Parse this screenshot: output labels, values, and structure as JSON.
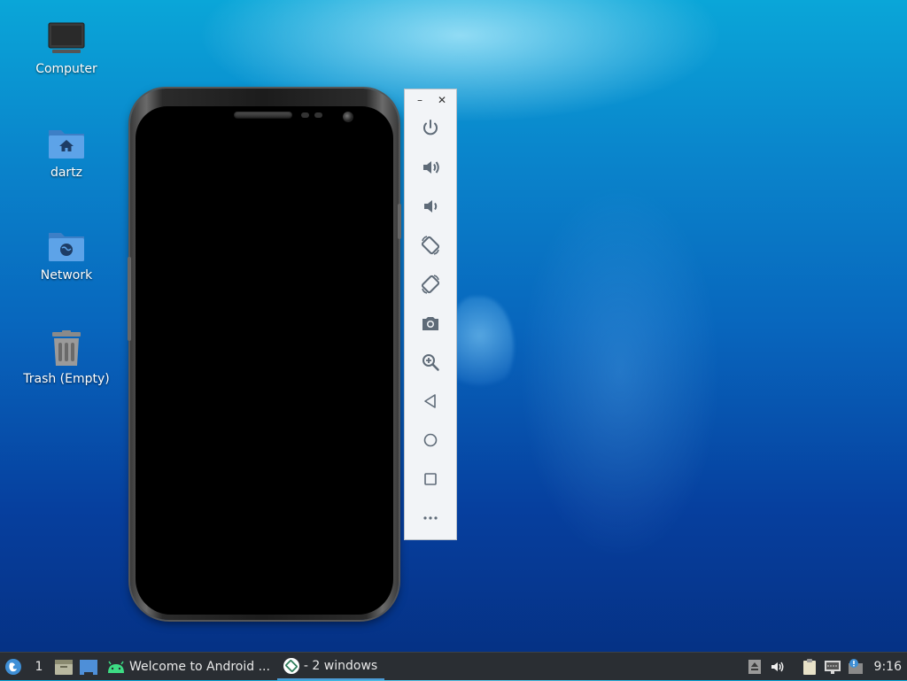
{
  "desktop": {
    "icons": [
      {
        "label": "Computer",
        "icon": "computer-icon"
      },
      {
        "label": "dartz",
        "icon": "home-folder-icon"
      },
      {
        "label": "Network",
        "icon": "network-folder-icon"
      },
      {
        "label": "Trash (Empty)",
        "icon": "trash-icon"
      }
    ]
  },
  "emulator": {
    "window_controls": {
      "minimize": "–",
      "close": "✕"
    },
    "toolbar_buttons": [
      {
        "name": "power-icon"
      },
      {
        "name": "volume-up-icon"
      },
      {
        "name": "volume-down-icon"
      },
      {
        "name": "rotate-left-icon"
      },
      {
        "name": "rotate-right-icon"
      },
      {
        "name": "camera-icon"
      },
      {
        "name": "zoom-icon"
      },
      {
        "name": "back-icon"
      },
      {
        "name": "home-icon"
      },
      {
        "name": "overview-icon"
      },
      {
        "name": "more-icon"
      }
    ]
  },
  "taskbar": {
    "workspace": "1",
    "tasks": [
      {
        "label": "Welcome to Android ...",
        "icon": "android-icon"
      },
      {
        "label": "- 2 windows",
        "icon": "emulator-icon"
      }
    ],
    "clock": "9:16"
  },
  "colors": {
    "accent": "#4b9bd6",
    "taskbar_bg": "#2a2e33",
    "toolbar_bg": "#f2f4f7",
    "toolbar_icon": "#5f6b78"
  }
}
